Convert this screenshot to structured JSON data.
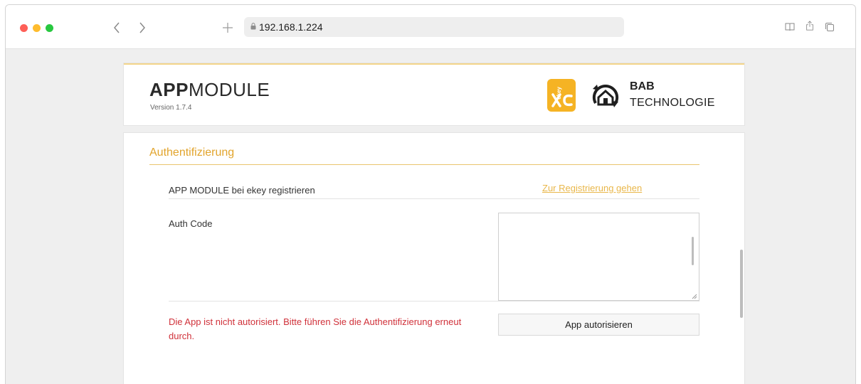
{
  "browser": {
    "url": "192.168.1.224",
    "icons": [
      "traffic-light-close",
      "traffic-light-minimize",
      "traffic-light-zoom",
      "chevron-left-icon",
      "chevron-right-icon",
      "plus-icon",
      "lock-icon",
      "reader-icon",
      "share-icon",
      "tabs-icon"
    ]
  },
  "header": {
    "title_bold": "APP",
    "title_light": "MODULE",
    "version": "Version 1.7.4",
    "ekey_logo_text": "ekey",
    "bab_line1": "BAB",
    "bab_line2": "TECHNOLOGIE"
  },
  "auth": {
    "section_title": "Authentifizierung",
    "register_label": "APP MODULE bei ekey registrieren",
    "register_link": "Zur Registrierung gehen",
    "auth_code_label": "Auth Code",
    "auth_code_value": "",
    "error_message": "Die App ist nicht autorisiert. Bitte führen Sie die Authentifizierung erneut durch.",
    "authorize_button": "App autorisieren"
  },
  "colors": {
    "accent": "#e2a42c",
    "link": "#e9b74a",
    "error": "#d0313a",
    "ekey_orange": "#f5b324"
  }
}
